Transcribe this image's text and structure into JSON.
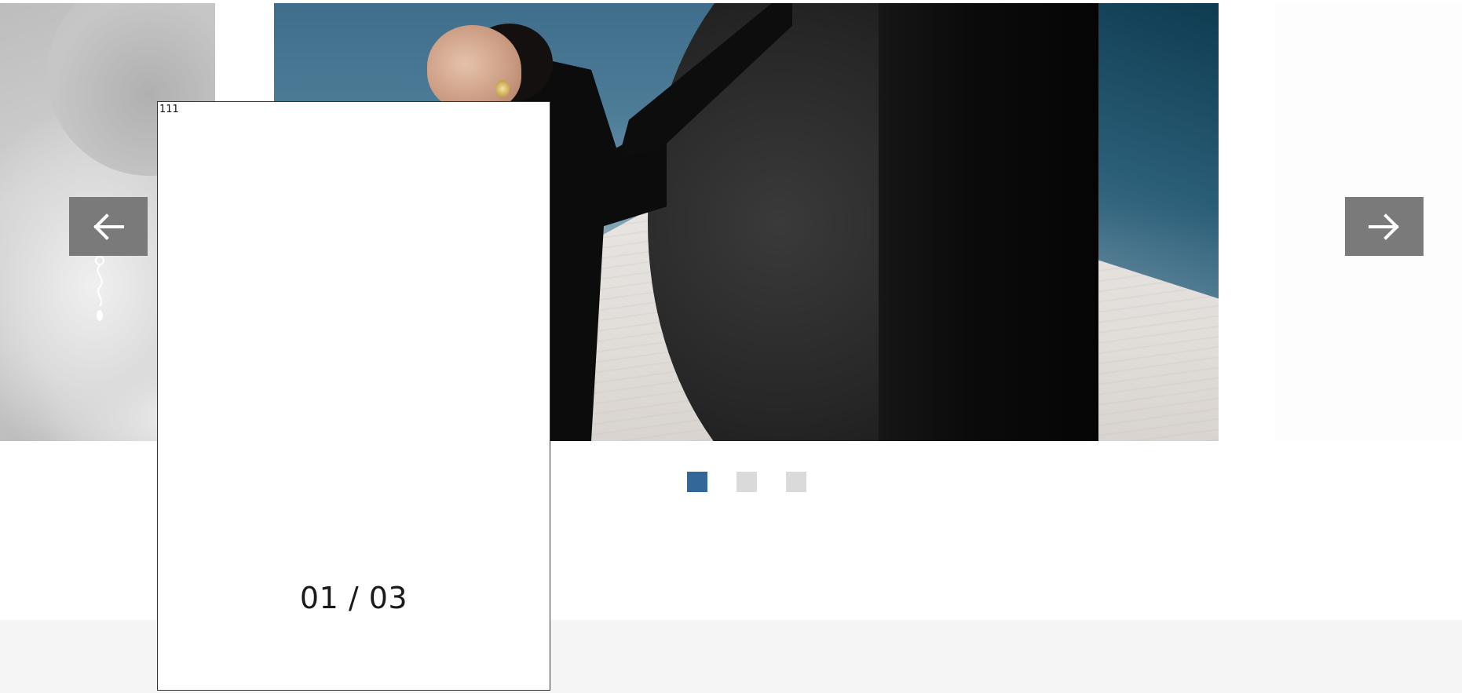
{
  "carousel": {
    "slides": [
      {
        "id": "slide-1",
        "state": "previous"
      },
      {
        "id": "slide-2",
        "state": "active"
      },
      {
        "id": "slide-3",
        "state": "next"
      }
    ],
    "prev_arrow_icon": "arrow-left-icon",
    "next_arrow_icon": "arrow-right-icon",
    "active_dot_index": 0,
    "dot_count": 3
  },
  "overlay": {
    "label": "111",
    "counter": "01 / 03"
  },
  "colors": {
    "active_dot": "#336699",
    "inactive_dot": "#dadada",
    "arrow_bg": "#7a7a7a",
    "footer_band": "#f5f5f5"
  }
}
